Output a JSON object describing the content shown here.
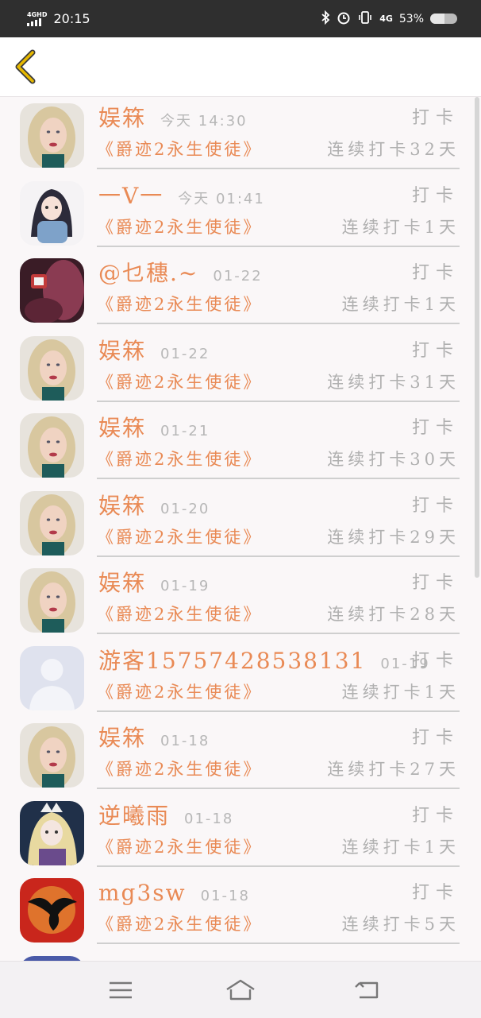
{
  "status_bar": {
    "network": "4GHD",
    "time": "20:15",
    "network_right": "4G",
    "battery_text": "53%",
    "battery_level": 0.53,
    "icons": [
      "bluetooth-icon",
      "alarm-icon",
      "vibrate-icon"
    ]
  },
  "header": {
    "back_icon": "chevron-left-icon",
    "accent_color": "#e6b800"
  },
  "colors": {
    "name": "#e98a55",
    "meta": "#b0b0b0",
    "divider": "#cfcfcf",
    "background": "#faf7f8"
  },
  "entries": [
    {
      "username": "娱箖",
      "time": "今天 14:30",
      "label": "打卡",
      "book": "《爵迹2永生使徒》",
      "streak": "连续打卡32天",
      "avatar": "blonde-woman-avatar"
    },
    {
      "username": "一V一",
      "time": "今天 01:41",
      "label": "打卡",
      "book": "《爵迹2永生使徒》",
      "streak": "连续打卡1天",
      "avatar": "anime-girl-avatar"
    },
    {
      "username": "@乜穗.~",
      "time": "01-22",
      "label": "打卡",
      "book": "《爵迹2永生使徒》",
      "streak": "连续打卡1天",
      "avatar": "dark-photo-avatar"
    },
    {
      "username": "娱箖",
      "time": "01-22",
      "label": "打卡",
      "book": "《爵迹2永生使徒》",
      "streak": "连续打卡31天",
      "avatar": "blonde-woman-avatar"
    },
    {
      "username": "娱箖",
      "time": "01-21",
      "label": "打卡",
      "book": "《爵迹2永生使徒》",
      "streak": "连续打卡30天",
      "avatar": "blonde-woman-avatar"
    },
    {
      "username": "娱箖",
      "time": "01-20",
      "label": "打卡",
      "book": "《爵迹2永生使徒》",
      "streak": "连续打卡29天",
      "avatar": "blonde-woman-avatar"
    },
    {
      "username": "娱箖",
      "time": "01-19",
      "label": "打卡",
      "book": "《爵迹2永生使徒》",
      "streak": "连续打卡28天",
      "avatar": "blonde-woman-avatar"
    },
    {
      "username": "游客15757428538131",
      "time": "01-19",
      "label": "打卡",
      "book": "《爵迹2永生使徒》",
      "streak": "连续打卡1天",
      "avatar": "default-user-avatar"
    },
    {
      "username": "娱箖",
      "time": "01-18",
      "label": "打卡",
      "book": "《爵迹2永生使徒》",
      "streak": "连续打卡27天",
      "avatar": "blonde-woman-avatar"
    },
    {
      "username": "逆曦雨",
      "time": "01-18",
      "label": "打卡",
      "book": "《爵迹2永生使徒》",
      "streak": "连续打卡1天",
      "avatar": "anime-fantasy-avatar"
    },
    {
      "username": "mg3sw",
      "time": "01-18",
      "label": "打卡",
      "book": "《爵迹2永生使徒》",
      "streak": "连续打卡5天",
      "avatar": "red-dragon-avatar"
    }
  ],
  "nav": {
    "items": [
      "menu-icon",
      "home-icon",
      "back-icon"
    ]
  }
}
